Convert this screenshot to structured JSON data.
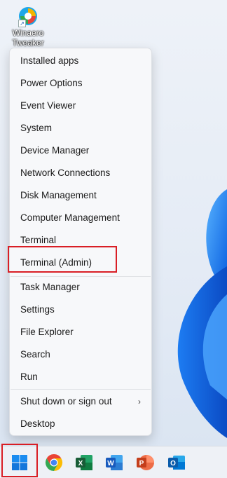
{
  "desktop": {
    "shortcut_label": "Winaero Tweaker",
    "shortcut_icon": "winaero-tweaker-icon"
  },
  "menu": {
    "items": [
      {
        "label": "Installed apps"
      },
      {
        "label": "Power Options"
      },
      {
        "label": "Event Viewer"
      },
      {
        "label": "System"
      },
      {
        "label": "Device Manager"
      },
      {
        "label": "Network Connections"
      },
      {
        "label": "Disk Management"
      },
      {
        "label": "Computer Management"
      },
      {
        "label": "Terminal"
      },
      {
        "label": "Terminal (Admin)"
      },
      {
        "label": "Task Manager"
      },
      {
        "label": "Settings"
      },
      {
        "label": "File Explorer"
      },
      {
        "label": "Search"
      },
      {
        "label": "Run"
      },
      {
        "label": "Shut down or sign out"
      },
      {
        "label": "Desktop"
      }
    ],
    "highlighted_item": "Terminal (Admin)",
    "submenu_chevron": "›"
  },
  "taskbar": {
    "apps": [
      "start-button",
      "chrome-icon",
      "excel-icon",
      "word-icon",
      "powerpoint-icon",
      "outlook-icon"
    ]
  },
  "colors": {
    "highlight_border": "#d91e25",
    "accent": "#0a64d8"
  }
}
